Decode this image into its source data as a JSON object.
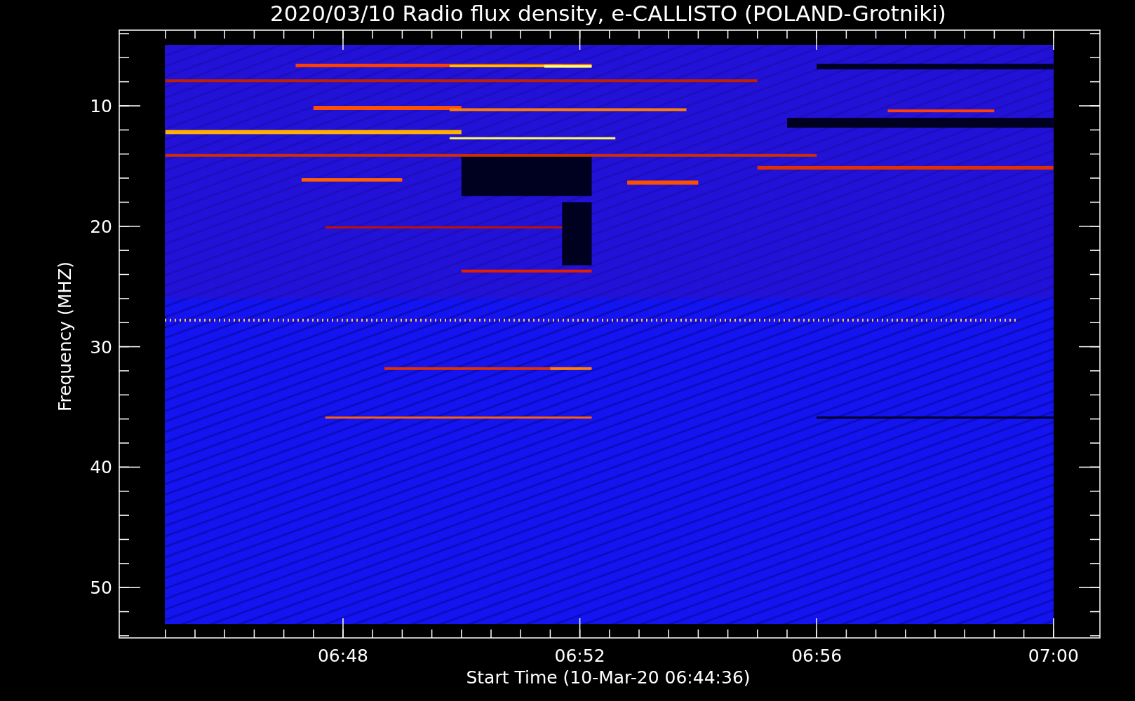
{
  "title": "2020/03/10  Radio flux density, e-CALLISTO (POLAND-Grotniki)",
  "y_axis": {
    "label": "Frequency (MHZ)",
    "ticks": [
      "10",
      "20",
      "30",
      "40",
      "50"
    ]
  },
  "x_axis": {
    "label": "Start Time (10-Mar-20 06:44:36)",
    "ticks": [
      "06:48",
      "06:52",
      "06:56",
      "07:00"
    ]
  }
}
